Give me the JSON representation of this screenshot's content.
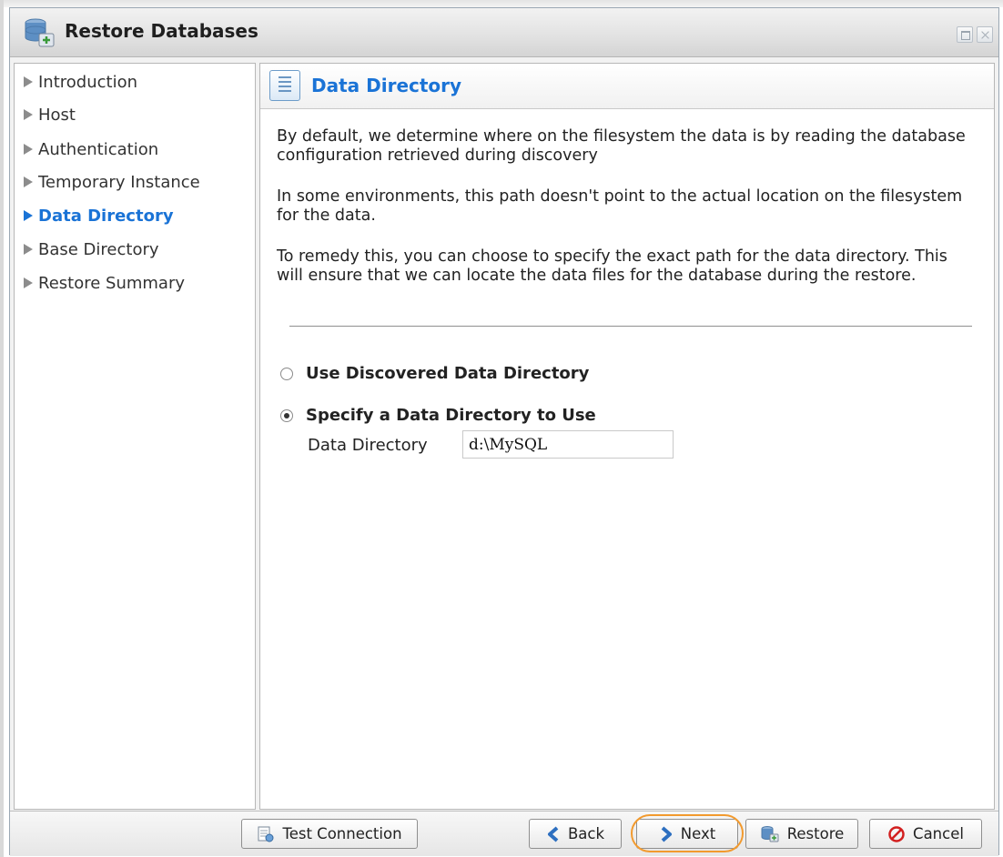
{
  "window": {
    "title": "Restore Databases"
  },
  "sidebar": {
    "items": [
      {
        "label": "Introduction",
        "active": false
      },
      {
        "label": "Host",
        "active": false
      },
      {
        "label": "Authentication",
        "active": false
      },
      {
        "label": "Temporary Instance",
        "active": false
      },
      {
        "label": "Data Directory",
        "active": true
      },
      {
        "label": "Base Directory",
        "active": false
      },
      {
        "label": "Restore Summary",
        "active": false
      }
    ]
  },
  "content": {
    "header_title": "Data Directory",
    "paragraphs": [
      "By default, we determine where on the filesystem the data is by reading the database configuration retrieved during discovery",
      "In some environments, this path doesn't point to the actual location on the filesystem for the data.",
      "To remedy this, you can choose to specify the exact path for the data directory. This will ensure that we can locate the data files for the database during the restore."
    ],
    "options": [
      {
        "label": "Use Discovered Data Directory",
        "checked": false
      },
      {
        "label": "Specify a Data Directory to Use",
        "checked": true
      }
    ],
    "field": {
      "label": "Data Directory",
      "value": "d:\\MySQL"
    }
  },
  "footer": {
    "test_connection": "Test Connection",
    "back": "Back",
    "next": "Next",
    "restore": "Restore",
    "cancel": "Cancel"
  },
  "colors": {
    "accent": "#1a73d6",
    "highlight": "#f29a2e"
  }
}
